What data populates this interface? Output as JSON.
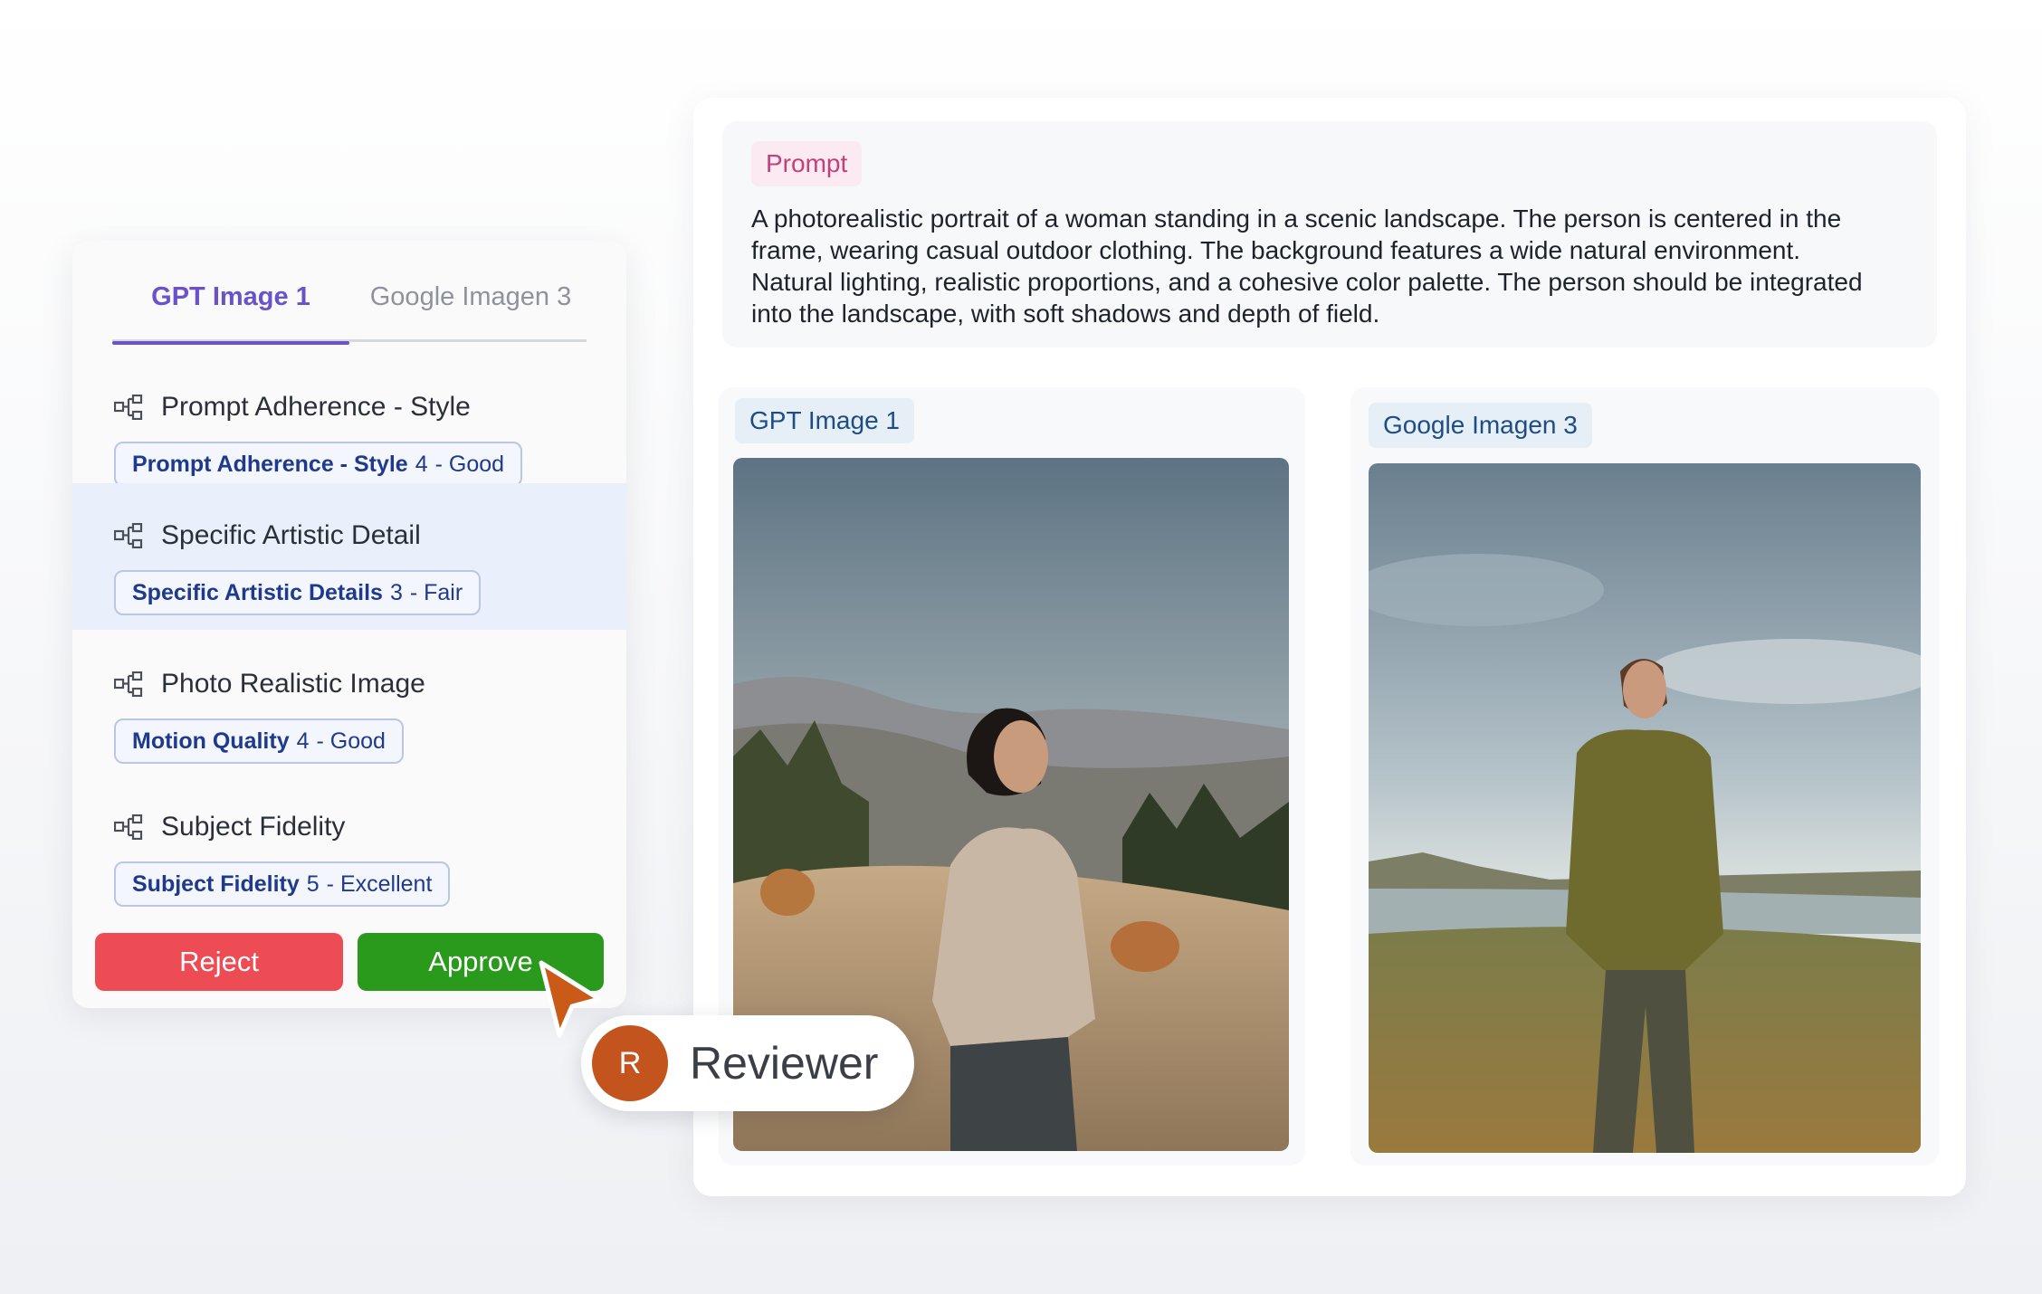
{
  "rating_panel": {
    "tabs": [
      {
        "label": "GPT Image 1",
        "active": true
      },
      {
        "label": "Google Imagen 3",
        "active": false
      }
    ],
    "criteria": [
      {
        "title": "Prompt Adherence - Style",
        "badge_name": "Prompt Adherence - Style",
        "score": "4",
        "rating": "- Good",
        "icon": "hierarchy-icon"
      },
      {
        "title": "Specific Artistic Detail",
        "badge_name": "Specific Artistic Details",
        "score": "3",
        "rating": "- Fair",
        "icon": "hierarchy-icon",
        "highlighted": true
      },
      {
        "title": "Photo Realistic Image",
        "badge_name": "Motion Quality",
        "score": "4",
        "rating": "- Good",
        "icon": "hierarchy-icon"
      },
      {
        "title": "Subject Fidelity",
        "badge_name": "Subject Fidelity",
        "score": "5",
        "rating": "- Excellent",
        "icon": "hierarchy-icon"
      }
    ],
    "reject_label": "Reject",
    "approve_label": "Approve"
  },
  "compare": {
    "prompt_tag": "Prompt",
    "prompt_lines": [
      "A photorealistic portrait of a woman standing in a scenic landscape. The person is centered in the",
      "frame, wearing casual outdoor clothing. The background features a wide natural environment.",
      "Natural lighting, realistic proportions, and a cohesive color palette. The person should be integrated",
      "into the landscape, with soft shadows and depth of field."
    ],
    "image_1_label": "GPT Image 1",
    "image_2_label": "Google Imagen 3"
  },
  "reviewer": {
    "initial": "R",
    "name": "Reviewer"
  },
  "colors": {
    "accent_tab": "#6b52c9",
    "reject": "#ee4c55",
    "approve": "#2a9a1d",
    "avatar": "#c4541d",
    "prompt_tag": "#c2407b",
    "badge_text": "#1f3a8c"
  }
}
